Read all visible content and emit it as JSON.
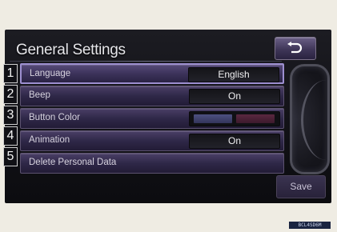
{
  "screen": {
    "title": "General Settings"
  },
  "rows": [
    {
      "num": "1",
      "label": "Language",
      "value": "English"
    },
    {
      "num": "2",
      "label": "Beep",
      "value": "On"
    },
    {
      "num": "3",
      "label": "Button Color",
      "colors": [
        "#4d5080",
        "#5a2840"
      ]
    },
    {
      "num": "4",
      "label": "Animation",
      "value": "On"
    },
    {
      "num": "5",
      "label": "Delete Personal Data"
    }
  ],
  "buttons": {
    "back_icon": "return-arrow-icon",
    "save_label": "Save"
  },
  "footer": {
    "code": "BCL4SD6M"
  }
}
